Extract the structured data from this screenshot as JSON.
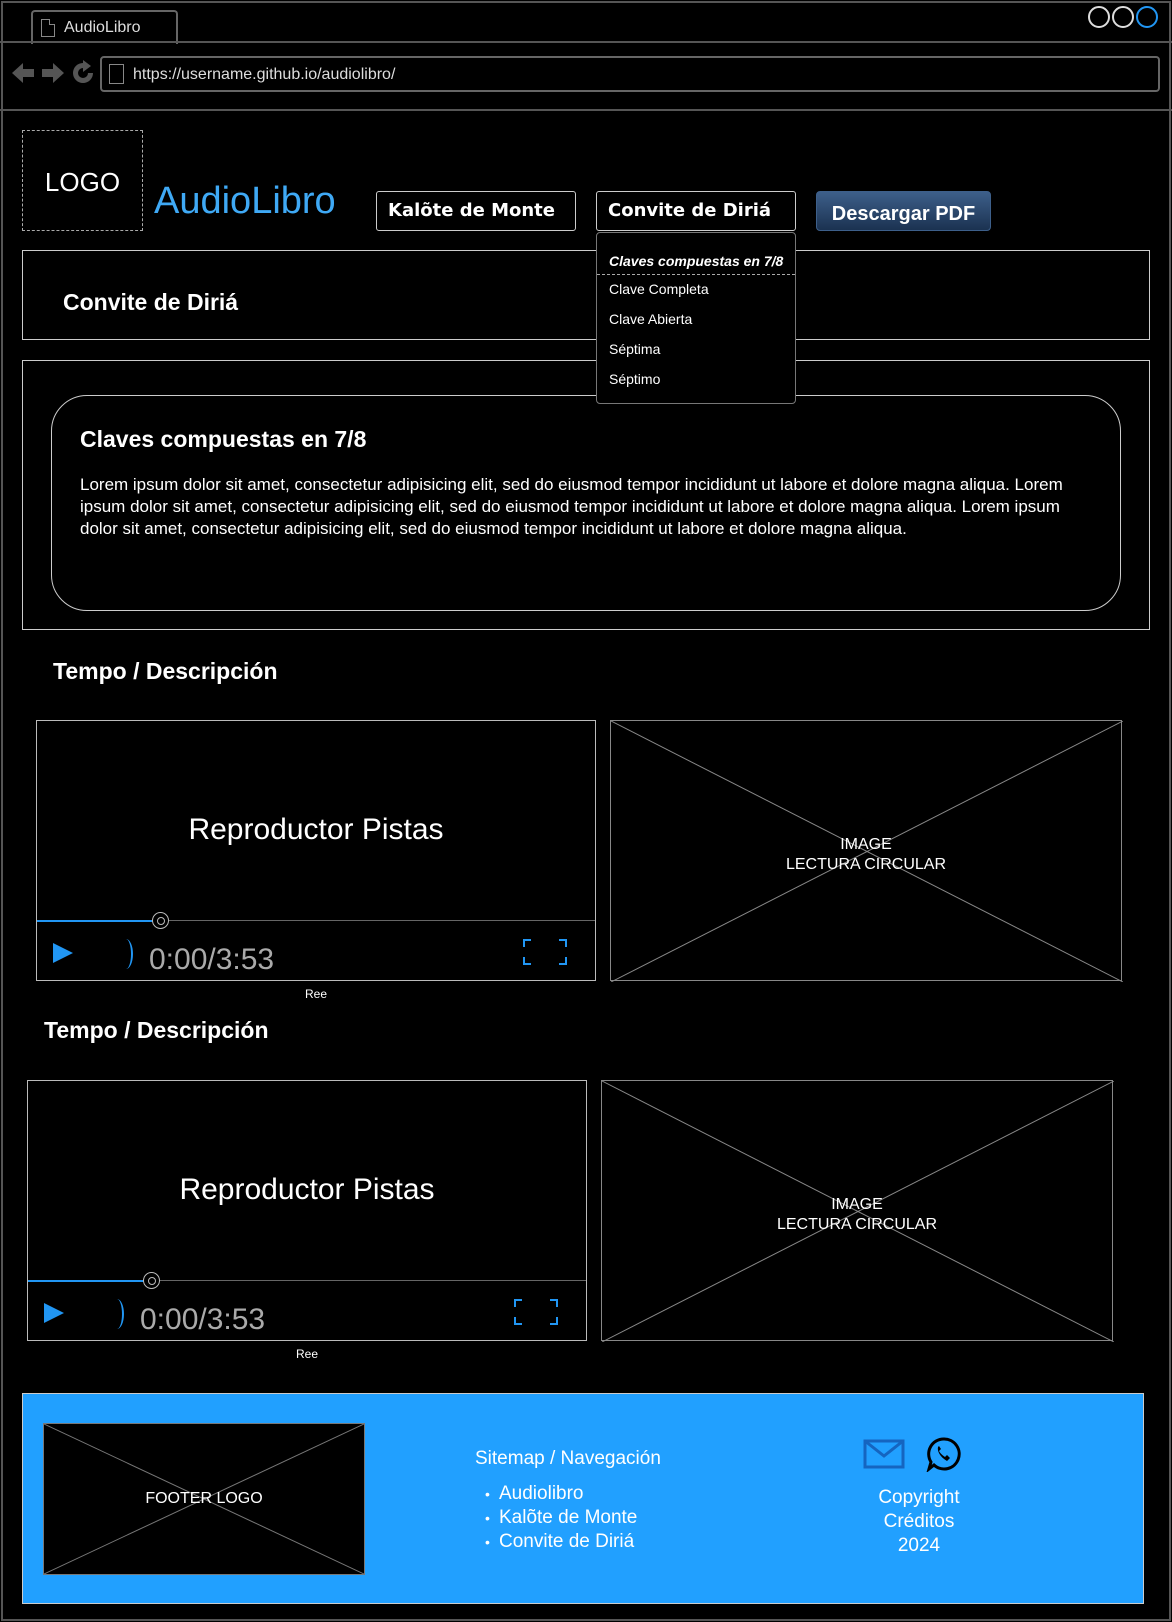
{
  "browser": {
    "tab_title": "AudioLibro",
    "url": "https://username.github.io/audiolibro/"
  },
  "header": {
    "logo_label": "LOGO",
    "brand": "AudioLibro",
    "nav": {
      "kalote": "Kalõte de Monte",
      "convite": "Convite de Diriá"
    },
    "pdf_button": "Descargar PDF"
  },
  "dropdown": {
    "heading": "Claves compuestas en 7/8",
    "items": [
      "Clave Completa",
      "Clave Abierta",
      "Séptima",
      "Séptimo"
    ]
  },
  "page_title": "Convite de Diriá",
  "content": {
    "heading": "Claves compuestas en 7/8",
    "body": "Lorem ipsum dolor sit amet, consectetur adipisicing elit, sed do eiusmod tempor incididunt ut labore et dolore magna aliqua. Lorem ipsum dolor sit amet, consectetur adipisicing elit, sed do eiusmod tempor incididunt ut labore et dolore magna aliqua. Lorem ipsum dolor sit amet, consectetur adipisicing elit, sed do eiusmod tempor incididunt ut labore et dolore magna aliqua."
  },
  "sections": [
    {
      "title": "Tempo / Descripción",
      "player_title": "Reproductor Pistas",
      "time": "0:00/3:53",
      "progress_fraction": 0.22,
      "caption": "Ree",
      "image_label_1": "IMAGE",
      "image_label_2": "LECTURA CIRCULAR"
    },
    {
      "title": "Tempo / Descripción",
      "player_title": "Reproductor Pistas",
      "time": "0:00/3:53",
      "progress_fraction": 0.22,
      "caption": "Ree",
      "image_label_1": "IMAGE",
      "image_label_2": "LECTURA CIRCULAR"
    }
  ],
  "footer": {
    "logo_label": "FOOTER LOGO",
    "sitemap_title": "Sitemap / Navegación",
    "sitemap_items": [
      "Audiolibro",
      "Kalõte de Monte",
      "Convite de Diriá"
    ],
    "copyright": "Copyright",
    "credits": "Créditos",
    "year": "2024"
  },
  "colors": {
    "accent": "#2196f3",
    "brand": "#3fa9f5",
    "footer_bg": "#21a0ff",
    "pdf_button": "#1b3251"
  },
  "icons": [
    "back-arrow-icon",
    "forward-arrow-icon",
    "reload-icon",
    "page-icon",
    "play-icon",
    "volume-icon",
    "fullscreen-icon",
    "mail-icon",
    "whatsapp-icon"
  ]
}
